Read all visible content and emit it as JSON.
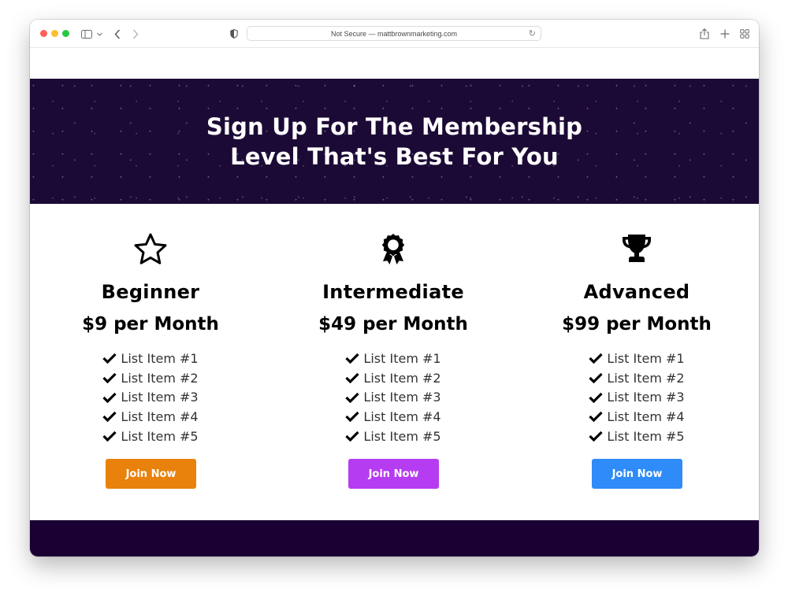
{
  "browser": {
    "address_text": "Not Secure — mattbrownmarketing.com",
    "icons": [
      "sidebar-icon",
      "chevron-down-icon",
      "back-icon",
      "forward-icon",
      "shield-icon",
      "reload-icon",
      "share-icon",
      "new-tab-icon",
      "tab-overview-icon"
    ]
  },
  "hero": {
    "title": "Sign Up For The Membership Level That's Best For You"
  },
  "plans": [
    {
      "icon": "star-icon",
      "name": "Beginner",
      "price": "$9 per Month",
      "features": [
        "List Item #1",
        "List Item #2",
        "List Item #3",
        "List Item #4",
        "List Item #5"
      ],
      "button_label": "Join Now",
      "button_color": "#e8820c"
    },
    {
      "icon": "award-ribbon-icon",
      "name": "Intermediate",
      "price": "$49 per Month",
      "features": [
        "List Item #1",
        "List Item #2",
        "List Item #3",
        "List Item #4",
        "List Item #5"
      ],
      "button_label": "Join Now",
      "button_color": "#b63cf2"
    },
    {
      "icon": "trophy-icon",
      "name": "Advanced",
      "price": "$99 per Month",
      "features": [
        "List Item #1",
        "List Item #2",
        "List Item #3",
        "List Item #4",
        "List Item #5"
      ],
      "button_label": "Join Now",
      "button_color": "#2f8bf8"
    }
  ],
  "colors": {
    "hero_bg": "#1c0a36",
    "footer_bg": "#1b0033"
  }
}
